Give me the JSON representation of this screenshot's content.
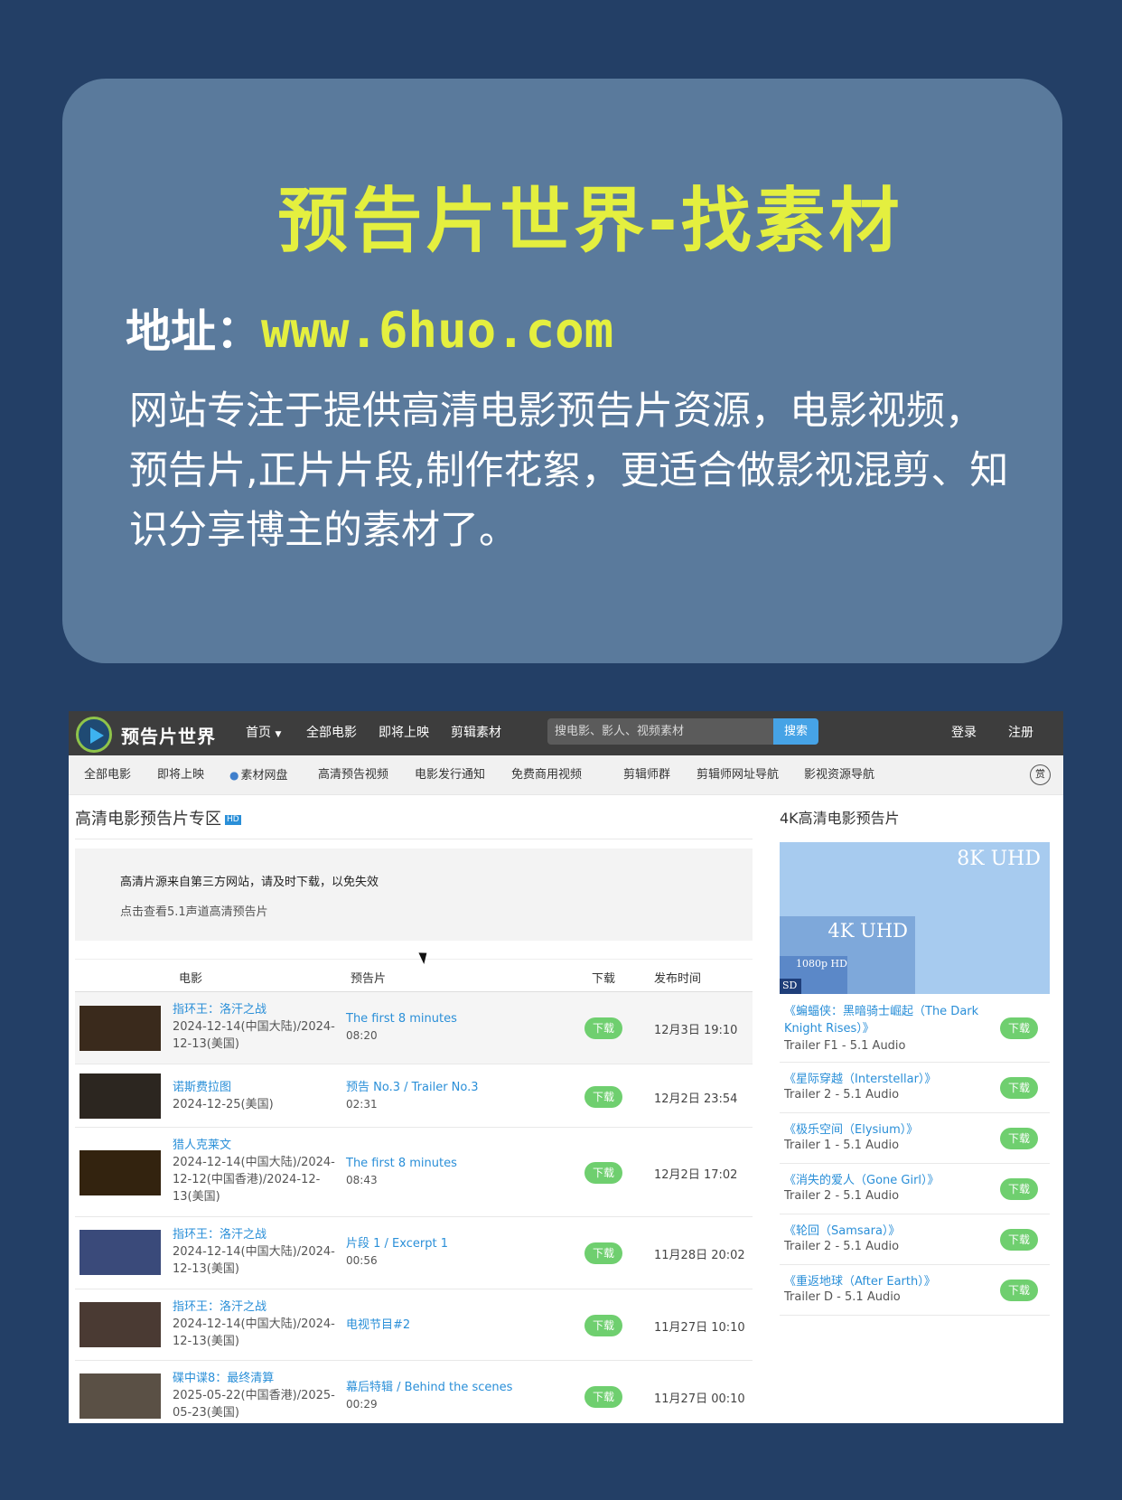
{
  "promo": {
    "title": "预告片世界-找素材",
    "address_label": "地址：",
    "address_url": "www.6huo.com",
    "description": "网站专注于提供高清电影预告片资源，电影视频，预告片,正片片段,制作花絮，更适合做影视混剪、知识分享博主的素材了。"
  },
  "site": {
    "logo_text": "预告片世界",
    "nav": [
      "首页",
      "全部电影",
      "即将上映",
      "剪辑素材"
    ],
    "search_placeholder": "搜电影、影人、视频素材",
    "search_button": "搜索",
    "login": "登录",
    "register": "注册",
    "subnav": [
      "全部电影",
      "即将上映",
      "素材网盘",
      "高清预告视频",
      "电影发行通知",
      "免费商用视频",
      "剪辑师群",
      "剪辑师网址导航",
      "影视资源导航"
    ],
    "round_icon": "赏"
  },
  "main": {
    "section_title": "高清电影预告片专区",
    "hd_badge": "HD",
    "notice_line1": "高清片源来自第三方网站，请及时下载，以免失效",
    "notice_line2": "点击查看5.1声道高清预告片",
    "headers": [
      "电影",
      "预告片",
      "下载",
      "发布时间"
    ],
    "download_label": "下载",
    "rows": [
      {
        "movie": "指环王：洛汗之战",
        "release": "2024-12-14(中国大陆)/2024-12-13(美国)",
        "trailer": "The first 8 minutes",
        "duration": "08:20",
        "time": "12月3日 19:10"
      },
      {
        "movie": "诺斯费拉图",
        "release": "2024-12-25(美国)",
        "trailer": "预告 No.3 / Trailer No.3",
        "duration": "02:31",
        "time": "12月2日 23:54"
      },
      {
        "movie": "猎人克莱文",
        "release": "2024-12-14(中国大陆)/2024-12-12(中国香港)/2024-12-13(美国)",
        "trailer": "The first 8 minutes",
        "duration": "08:43",
        "time": "12月2日 17:02"
      },
      {
        "movie": "指环王：洛汗之战",
        "release": "2024-12-14(中国大陆)/2024-12-13(美国)",
        "trailer": "片段 1 / Excerpt 1",
        "duration": "00:56",
        "time": "11月28日 20:02"
      },
      {
        "movie": "指环王：洛汗之战",
        "release": "2024-12-14(中国大陆)/2024-12-13(美国)",
        "trailer": "电视节目#2",
        "duration": "",
        "time": "11月27日 10:10"
      },
      {
        "movie": "碟中谍8：最终清算",
        "release": "2025-05-22(中国香港)/2025-05-23(美国)",
        "trailer": "幕后特辑 / Behind the scenes",
        "duration": "00:29",
        "time": "11月27日 00:10"
      }
    ]
  },
  "sidebar": {
    "title": "4K高清电影预告片",
    "uhd_labels": {
      "u8": "8K UHD",
      "u4": "4K UHD",
      "u1": "1080p HD",
      "sd": "SD"
    },
    "items": [
      {
        "title": "《蝙蝠侠：黑暗骑士崛起（The Dark Knight Rises）》",
        "sub": "Trailer F1 - 5.1 Audio"
      },
      {
        "title": "《星际穿越（Interstellar）》",
        "sub": "Trailer 2 - 5.1 Audio"
      },
      {
        "title": "《极乐空间（Elysium）》",
        "sub": "Trailer 1 - 5.1 Audio"
      },
      {
        "title": "《消失的爱人（Gone Girl）》",
        "sub": "Trailer 2 - 5.1 Audio"
      },
      {
        "title": "《轮回（Samsara）》",
        "sub": "Trailer 2 - 5.1 Audio"
      },
      {
        "title": "《重返地球（After Earth）》",
        "sub": "Trailer D - 5.1 Audio"
      }
    ]
  }
}
